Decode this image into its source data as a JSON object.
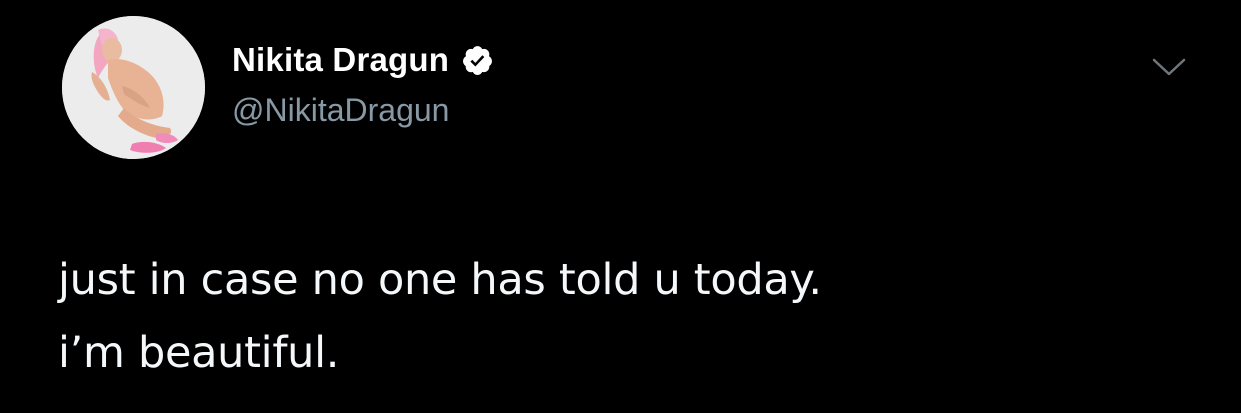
{
  "author": {
    "display_name": "Nikita Dragun",
    "handle": "@NikitaDragun",
    "verified": true,
    "avatar": "profile-photo"
  },
  "tweet": {
    "lines": [
      "just in case no one has told u today.",
      "i’m beautiful."
    ]
  },
  "icons": {
    "verified": "verified-badge-icon",
    "menu": "chevron-down-icon"
  },
  "colors": {
    "background": "#000000",
    "name": "#ffffff",
    "handle": "#8899a6",
    "text": "#f5f8fa",
    "chevron": "#6e767d"
  }
}
